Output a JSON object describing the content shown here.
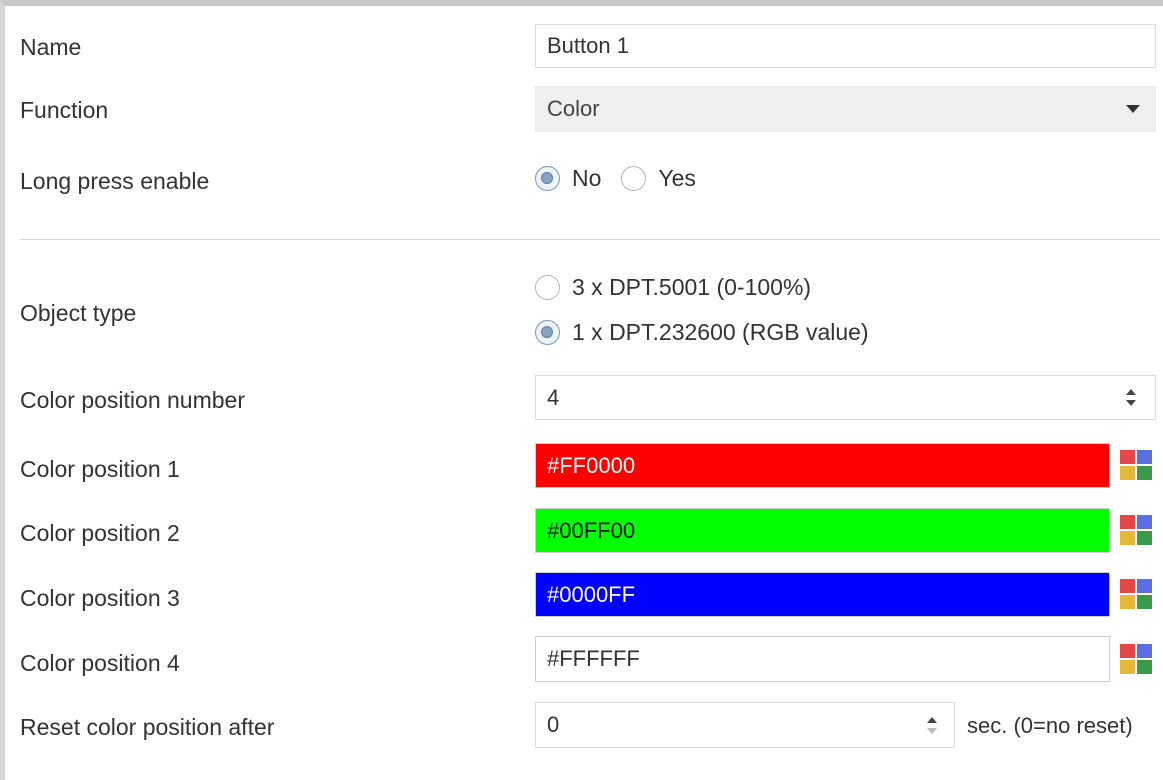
{
  "name": {
    "label": "Name",
    "value": "Button 1"
  },
  "function": {
    "label": "Function",
    "value": "Color"
  },
  "long_press": {
    "label": "Long press enable",
    "options": [
      "No",
      "Yes"
    ],
    "selected": "No"
  },
  "object_type": {
    "label": "Object type",
    "options": [
      "3 x DPT.5001 (0-100%)",
      "1 x DPT.232600 (RGB value)"
    ],
    "selected": "1 x DPT.232600 (RGB value)"
  },
  "color_position_number": {
    "label": "Color position number",
    "value": "4"
  },
  "color_positions": [
    {
      "label": "Color position 1",
      "value": "#FF0000",
      "bg": "#FF0000",
      "fg": "#ffffff"
    },
    {
      "label": "Color position 2",
      "value": "#00FF00",
      "bg": "#00FF00",
      "fg": "#1a1a1a"
    },
    {
      "label": "Color position 3",
      "value": "#0000FF",
      "bg": "#0000FF",
      "fg": "#ffffff"
    },
    {
      "label": "Color position 4",
      "value": "#FFFFFF",
      "bg": "#FFFFFF",
      "fg": "#333333"
    }
  ],
  "palette_icon": {
    "icon": "color-palette-icon",
    "colors": [
      "#e8474a",
      "#5a6fe0",
      "#e5b83a",
      "#3a9a4a"
    ]
  },
  "reset": {
    "label": "Reset color position after",
    "value": "0",
    "unit": "sec. (0=no reset)"
  }
}
